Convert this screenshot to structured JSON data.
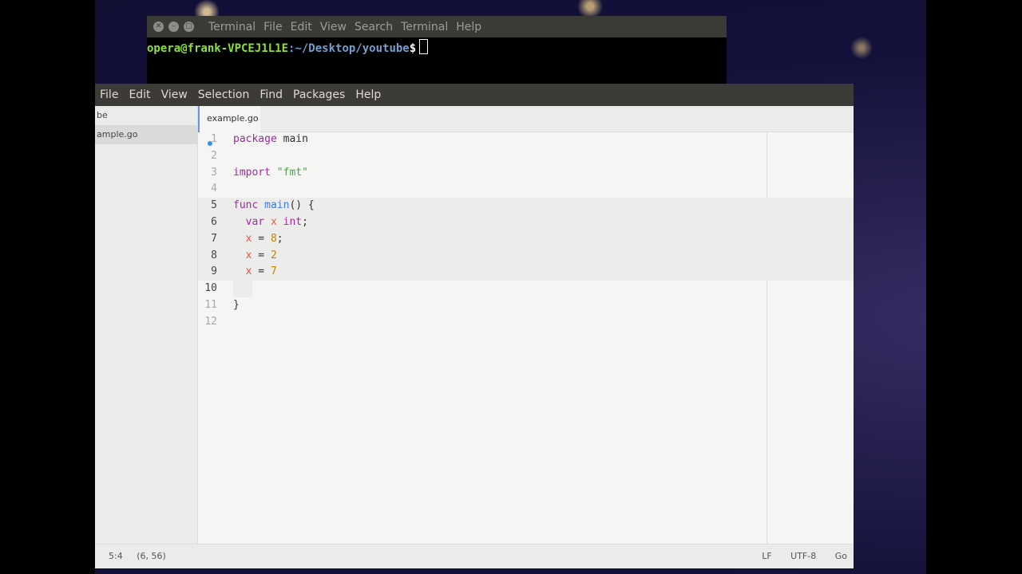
{
  "terminal": {
    "menu": [
      "Terminal",
      "File",
      "Edit",
      "View",
      "Search",
      "Terminal",
      "Help"
    ],
    "prompt_user": "opera@frank-VPCEJ1L1E",
    "prompt_path": ":~/Desktop/youtube",
    "prompt_symbol": "$"
  },
  "editor": {
    "menu": [
      "File",
      "Edit",
      "View",
      "Selection",
      "Find",
      "Packages",
      "Help"
    ],
    "tree": {
      "items": [
        "be",
        "ample.go"
      ],
      "selected_index": 1
    },
    "tab": {
      "label": "example.go",
      "modified": true
    },
    "lines": [
      {
        "n": "1"
      },
      {
        "n": "2"
      },
      {
        "n": "3"
      },
      {
        "n": "4"
      },
      {
        "n": "5"
      },
      {
        "n": "6"
      },
      {
        "n": "7"
      },
      {
        "n": "8"
      },
      {
        "n": "9"
      },
      {
        "n": "10"
      },
      {
        "n": "11"
      },
      {
        "n": "12"
      }
    ],
    "code": {
      "l1": [
        "package",
        " main"
      ],
      "l3": [
        "import",
        " ",
        "\"fmt\""
      ],
      "l5": [
        "func",
        " ",
        "main",
        "() {"
      ],
      "l6": [
        "  ",
        "var",
        " ",
        "x",
        " ",
        "int",
        ";"
      ],
      "l7": [
        "  ",
        "x",
        " = ",
        "8",
        ";"
      ],
      "l8": [
        "  ",
        "x",
        " = ",
        "2"
      ],
      "l9": [
        "  ",
        "x",
        " = ",
        "7"
      ],
      "l11": [
        "}"
      ]
    },
    "status": {
      "cursor": "5:4",
      "selection": "(6, 56)",
      "line_ending": "LF",
      "encoding": "UTF-8",
      "grammar": "Go"
    }
  },
  "colors": {
    "keyword": "#a626a4",
    "function": "#4078f2",
    "string": "#50a14f",
    "variable": "#e45649",
    "number": "#c18401",
    "tab_accent": "#6494ed"
  }
}
